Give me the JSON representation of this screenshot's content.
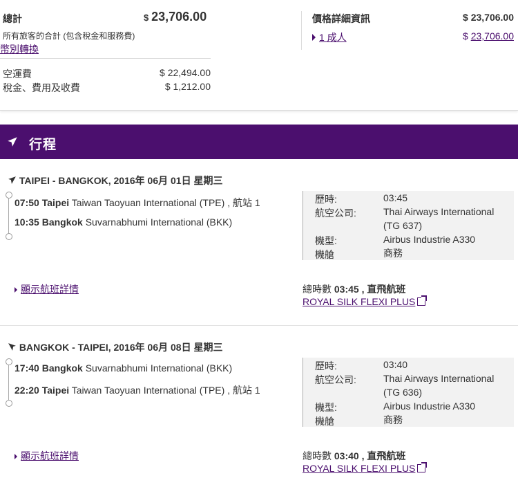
{
  "summary": {
    "total_label": "總計",
    "total_currency": "$",
    "total_amount": "23,706.00",
    "total_note": "所有旅客的合計 (包含稅金和服務費)",
    "currency_link": "幣別轉換",
    "fare_label": "空運費",
    "fare_amount": "$ 22,494.00",
    "tax_label": "稅金、費用及收費",
    "tax_amount": "$ 1,212.00",
    "price_detail_label": "價格詳細資訊",
    "price_detail_amount": "$ 23,706.00",
    "adult_link": "1 成人",
    "adult_currency": "$",
    "adult_amount": "23,706.00"
  },
  "itinerary": {
    "title": "行程",
    "icon": "airplane-icon"
  },
  "segments": [
    {
      "route": "TAIPEI - BANGKOK, 2016年 06月 01日 星期三",
      "depart_time": "07:50",
      "depart_city": "Taipei",
      "depart_airport": "Taiwan Taoyuan International (TPE) , 航站 1",
      "arrive_time": "10:35",
      "arrive_city": "Bangkok",
      "arrive_airport": "Suvarnabhumi International (BKK)",
      "duration_label": "歷時:",
      "duration": "03:45",
      "airline_label": "航空公司:",
      "airline": "Thai Airways International (TG 637)",
      "aircraft_label": "機型:",
      "aircraft": "Airbus Industrie A330",
      "cabin_label": "機艙",
      "cabin": "商務",
      "details_link": "顯示航班詳情",
      "total_time_label": "總時數",
      "total_time": "03:45 ,",
      "nonstop": "直飛航班",
      "fare_brand": "ROYAL SILK FLEXI PLUS"
    },
    {
      "route": "BANGKOK - TAIPEI, 2016年 06月 08日 星期三",
      "depart_time": "17:40",
      "depart_city": "Bangkok",
      "depart_airport": "Suvarnabhumi International (BKK)",
      "arrive_time": "22:20",
      "arrive_city": "Taipei",
      "arrive_airport": "Taiwan Taoyuan International (TPE) , 航站 1",
      "duration_label": "歷時:",
      "duration": "03:40",
      "airline_label": "航空公司:",
      "airline": "Thai Airways International (TG 636)",
      "aircraft_label": "機型:",
      "aircraft": "Airbus Industrie A330",
      "cabin_label": "機艙",
      "cabin": "商務",
      "details_link": "顯示航班詳情",
      "total_time_label": "總時數",
      "total_time": "03:40 ,",
      "nonstop": "直飛航班",
      "fare_brand": "ROYAL SILK FLEXI PLUS"
    }
  ],
  "colors": {
    "brand_purple": "#4b0f6e",
    "info_bg": "#f2f2f2"
  }
}
